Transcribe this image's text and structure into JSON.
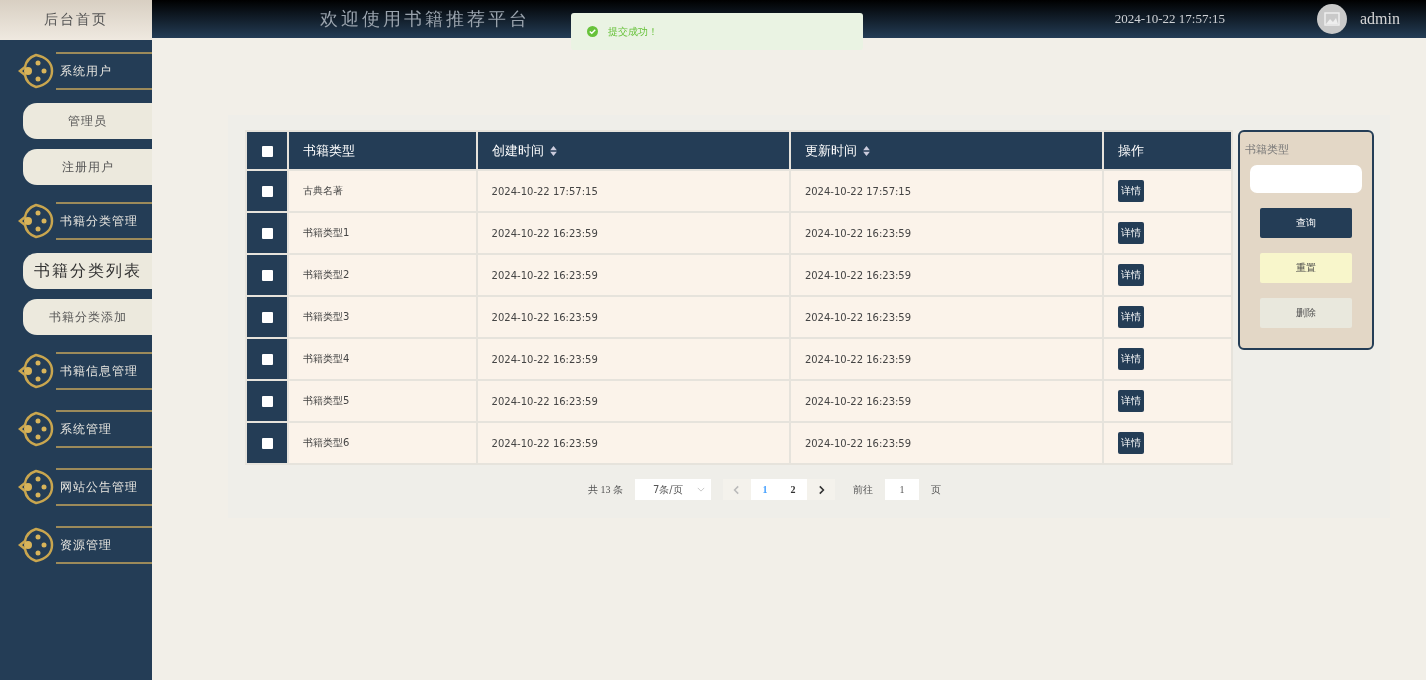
{
  "sidebar": {
    "home": "后台首页",
    "groups": [
      {
        "label": "系统用户",
        "children": [
          {
            "label": "管理员",
            "selected": false
          },
          {
            "label": "注册用户",
            "selected": false
          }
        ]
      },
      {
        "label": "书籍分类管理",
        "children": [
          {
            "label": "书籍分类列表",
            "selected": true
          },
          {
            "label": "书籍分类添加",
            "selected": false
          }
        ]
      },
      {
        "label": "书籍信息管理"
      },
      {
        "label": "系统管理"
      },
      {
        "label": "网站公告管理"
      },
      {
        "label": "资源管理"
      }
    ]
  },
  "header": {
    "title": "欢迎使用书籍推荐平台",
    "datetime": "2024-10-22 17:57:15",
    "user": "admin"
  },
  "toast": {
    "message": "提交成功！"
  },
  "table": {
    "select_all": {
      "checked": false
    },
    "columns": [
      {
        "label": "书籍类型",
        "sortable": false
      },
      {
        "label": "创建时间",
        "sortable": true
      },
      {
        "label": "更新时间",
        "sortable": true
      },
      {
        "label": "操作",
        "sortable": false
      }
    ],
    "rows": [
      {
        "checked": false,
        "name": "古典名著",
        "created": "2024-10-22 17:57:15",
        "updated": "2024-10-22 17:57:15",
        "action": "详情"
      },
      {
        "checked": false,
        "name": "书籍类型1",
        "created": "2024-10-22 16:23:59",
        "updated": "2024-10-22 16:23:59",
        "action": "详情"
      },
      {
        "checked": false,
        "name": "书籍类型2",
        "created": "2024-10-22 16:23:59",
        "updated": "2024-10-22 16:23:59",
        "action": "详情"
      },
      {
        "checked": false,
        "name": "书籍类型3",
        "created": "2024-10-22 16:23:59",
        "updated": "2024-10-22 16:23:59",
        "action": "详情"
      },
      {
        "checked": false,
        "name": "书籍类型4",
        "created": "2024-10-22 16:23:59",
        "updated": "2024-10-22 16:23:59",
        "action": "详情"
      },
      {
        "checked": false,
        "name": "书籍类型5",
        "created": "2024-10-22 16:23:59",
        "updated": "2024-10-22 16:23:59",
        "action": "详情"
      },
      {
        "checked": false,
        "name": "书籍类型6",
        "created": "2024-10-22 16:23:59",
        "updated": "2024-10-22 16:23:59",
        "action": "详情"
      }
    ]
  },
  "pagination": {
    "total": "共 13 条",
    "page_size": "7条/页",
    "pages": [
      {
        "label": "1",
        "selected": true
      },
      {
        "label": "2",
        "selected": false
      }
    ],
    "goto": "前往",
    "goto_value": "1",
    "goto_unit": "页"
  },
  "search": {
    "label": "书籍类型",
    "buttons": [
      {
        "kind": "query",
        "label": "查询"
      },
      {
        "kind": "reset",
        "label": "重置"
      },
      {
        "kind": "delete",
        "label": "删除"
      }
    ]
  }
}
